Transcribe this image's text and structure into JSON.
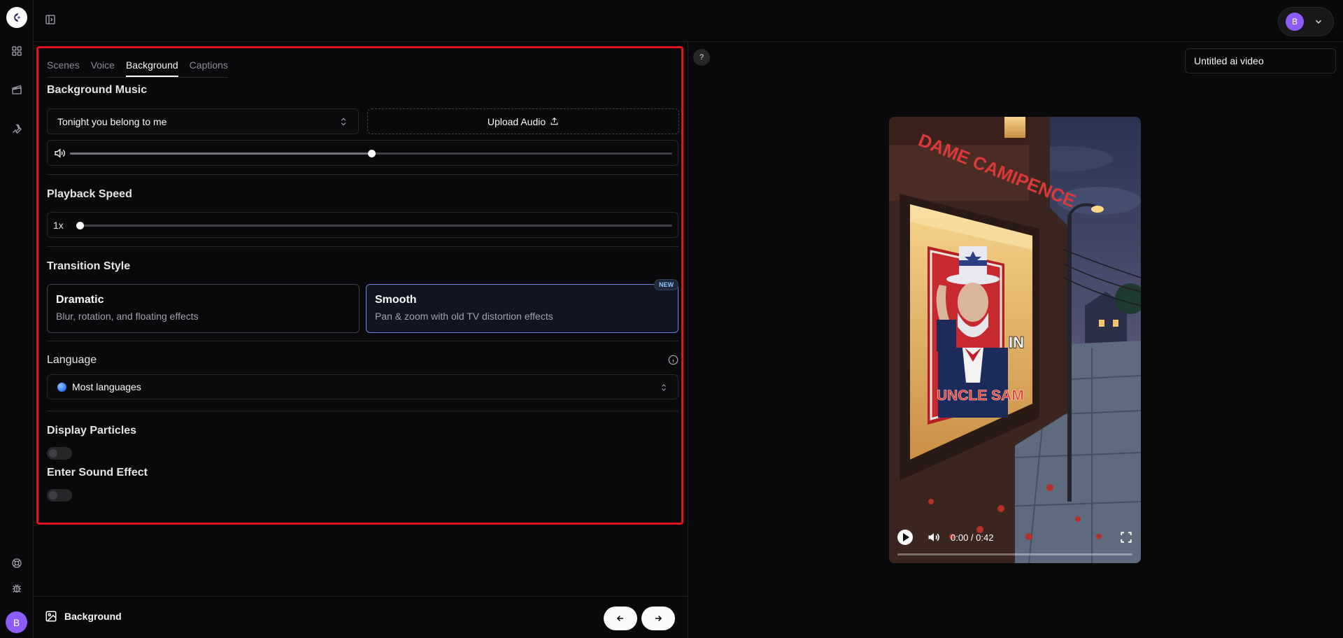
{
  "rail": {
    "icons": [
      "grid-icon",
      "clapperboard-icon",
      "wrench-icon",
      "support-icon",
      "bug-icon"
    ],
    "avatar_initial": "B"
  },
  "topbar": {
    "avatar_initial": "B"
  },
  "tabs": [
    {
      "label": "Scenes",
      "active": false
    },
    {
      "label": "Voice",
      "active": false
    },
    {
      "label": "Background",
      "active": true
    },
    {
      "label": "Captions",
      "active": false
    }
  ],
  "background_music": {
    "title": "Background Music",
    "selected_track": "Tonight you belong to me",
    "upload_label": "Upload Audio",
    "volume": 0.5
  },
  "playback_speed": {
    "title": "Playback Speed",
    "value_label": "1x",
    "position": 0.0
  },
  "transition_style": {
    "title": "Transition Style",
    "options": [
      {
        "title": "Dramatic",
        "description": "Blur, rotation, and floating effects",
        "selected": false
      },
      {
        "title": "Smooth",
        "description": "Pan & zoom with old TV distortion effects",
        "selected": true,
        "badge": "NEW"
      }
    ]
  },
  "language": {
    "title": "Language",
    "selected": "Most languages"
  },
  "display_particles": {
    "title": "Display Particles",
    "enabled": false
  },
  "enter_sound_effect": {
    "title": "Enter Sound Effect",
    "enabled": false
  },
  "footer": {
    "label": "Background"
  },
  "preview": {
    "help_label": "?",
    "video_title": "Untitled ai video",
    "time": "0:00 / 0:42",
    "progress": 0.0,
    "scene_text": {
      "storefront": "DAME CAMIPENCE",
      "poster": "UNCLE SAM",
      "caption": "IN"
    }
  }
}
